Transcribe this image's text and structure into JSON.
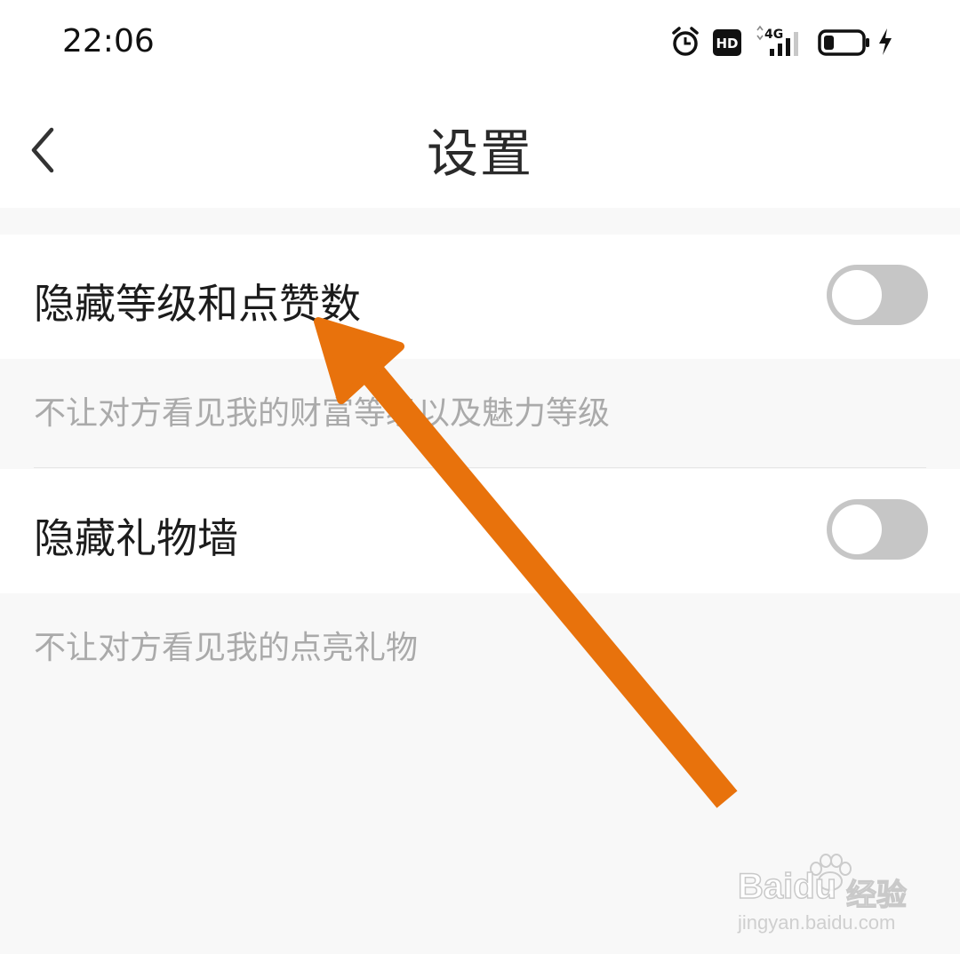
{
  "status_bar": {
    "time": "22:06",
    "hd_label": "HD",
    "network_label": "4G",
    "icons": [
      "alarm-icon",
      "hd-icon",
      "signal-4g-icon",
      "battery-icon",
      "charging-icon"
    ]
  },
  "nav": {
    "title": "设置",
    "back_icon": "chevron-left-icon"
  },
  "settings": [
    {
      "label": "隐藏等级和点赞数",
      "description": "不让对方看见我的财富等级以及魅力等级",
      "enabled": false
    },
    {
      "label": "隐藏礼物墙",
      "description": "不让对方看见我的点亮礼物",
      "enabled": false
    }
  ],
  "overlay": {
    "arrow_color": "#e8720c",
    "arrow_icon": "annotation-arrow-icon"
  },
  "watermark": {
    "brand": "Baidu",
    "service": "经验",
    "url": "jingyan.baidu.com"
  },
  "colors": {
    "toggle_off": "#c6c6c6",
    "background": "#f8f8f8",
    "secondary_text": "#aaaaaa"
  }
}
